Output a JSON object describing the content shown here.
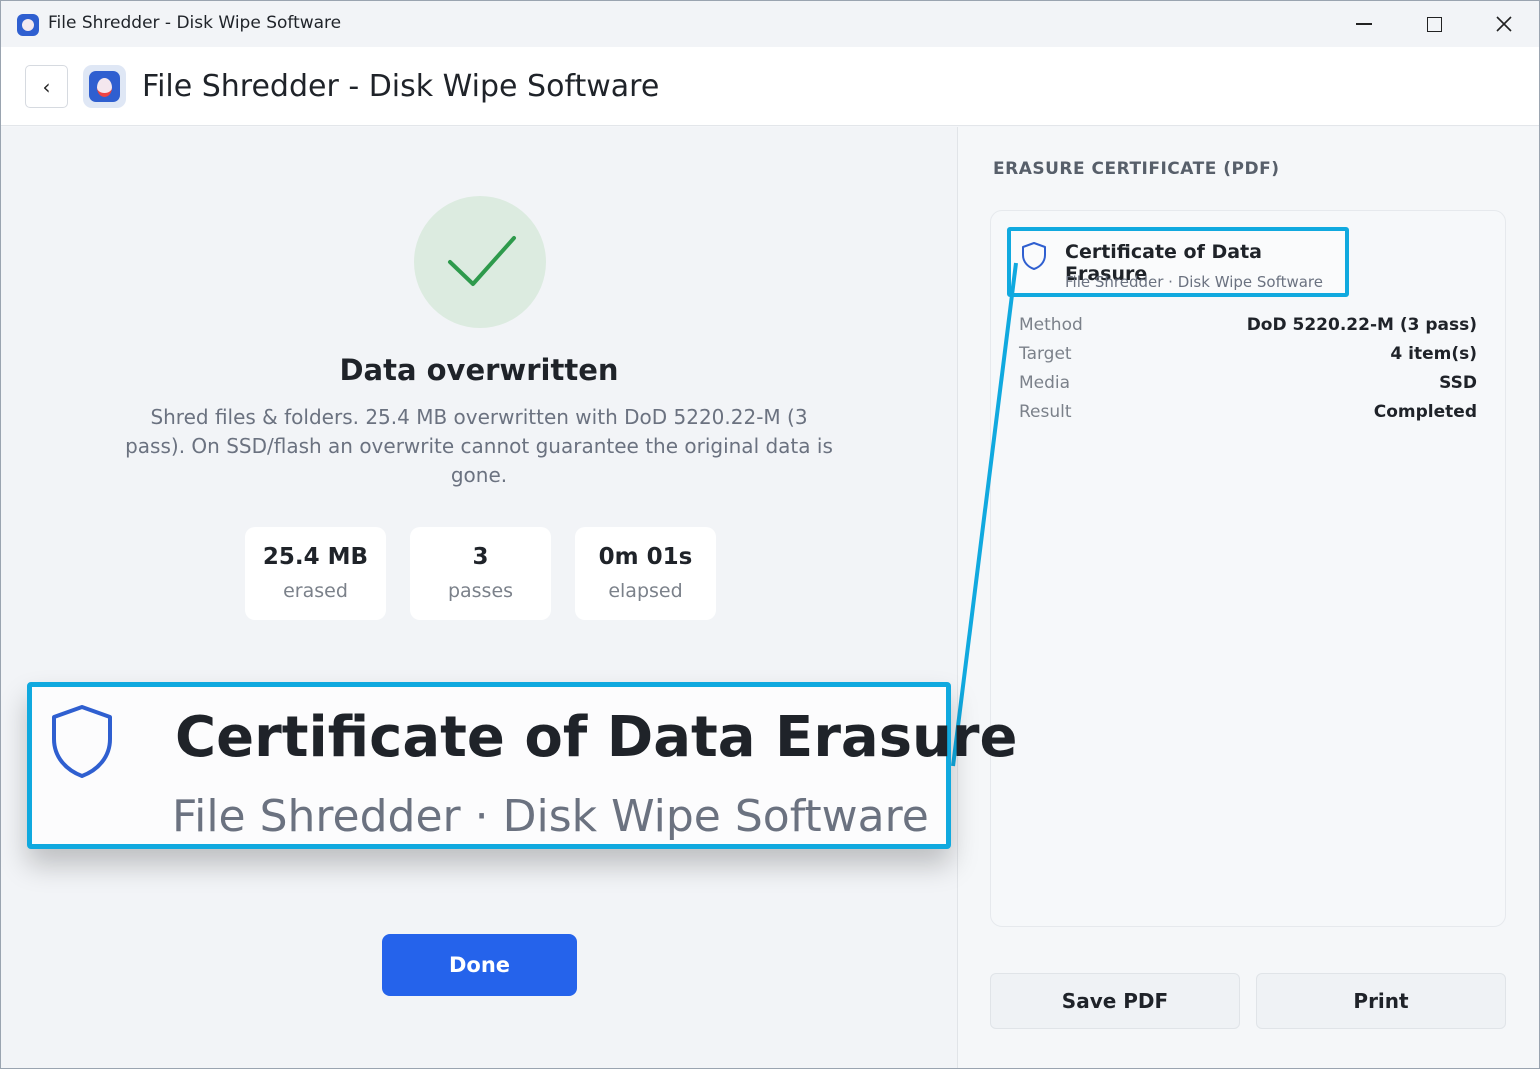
{
  "window": {
    "title": "File Shredder - Disk Wipe Software"
  },
  "header": {
    "back_label": "‹",
    "title": "File Shredder - Disk Wipe Software"
  },
  "result": {
    "title": "Data overwritten",
    "description": "Shred files & folders. 25.4 MB overwritten with DoD 5220.22-M (3 pass). On SSD/flash an overwrite cannot guarantee the original data is gone."
  },
  "stats": [
    {
      "value": "25.4 MB",
      "label": "erased"
    },
    {
      "value": "3",
      "label": "passes"
    },
    {
      "value": "0m 01s",
      "label": "elapsed"
    }
  ],
  "done_label": "Done",
  "certificate": {
    "section_title": "ERASURE CERTIFICATE (PDF)",
    "title": "Certificate of Data Erasure",
    "subtitle": "File Shredder · Disk Wipe Software",
    "rows": [
      {
        "key": "Method",
        "value": "DoD 5220.22-M (3 pass)"
      },
      {
        "key": "Target",
        "value": "4 item(s)"
      },
      {
        "key": "Media",
        "value": "SSD"
      },
      {
        "key": "Result",
        "value": "Completed"
      }
    ],
    "save_label": "Save PDF",
    "print_label": "Print"
  },
  "colors": {
    "accent": "#2563eb",
    "highlight": "#10a9df",
    "success": "#2e9a4c"
  },
  "icons": {
    "app": "shredder-app-icon",
    "check": "checkmark-icon",
    "shield": "shield-icon"
  }
}
